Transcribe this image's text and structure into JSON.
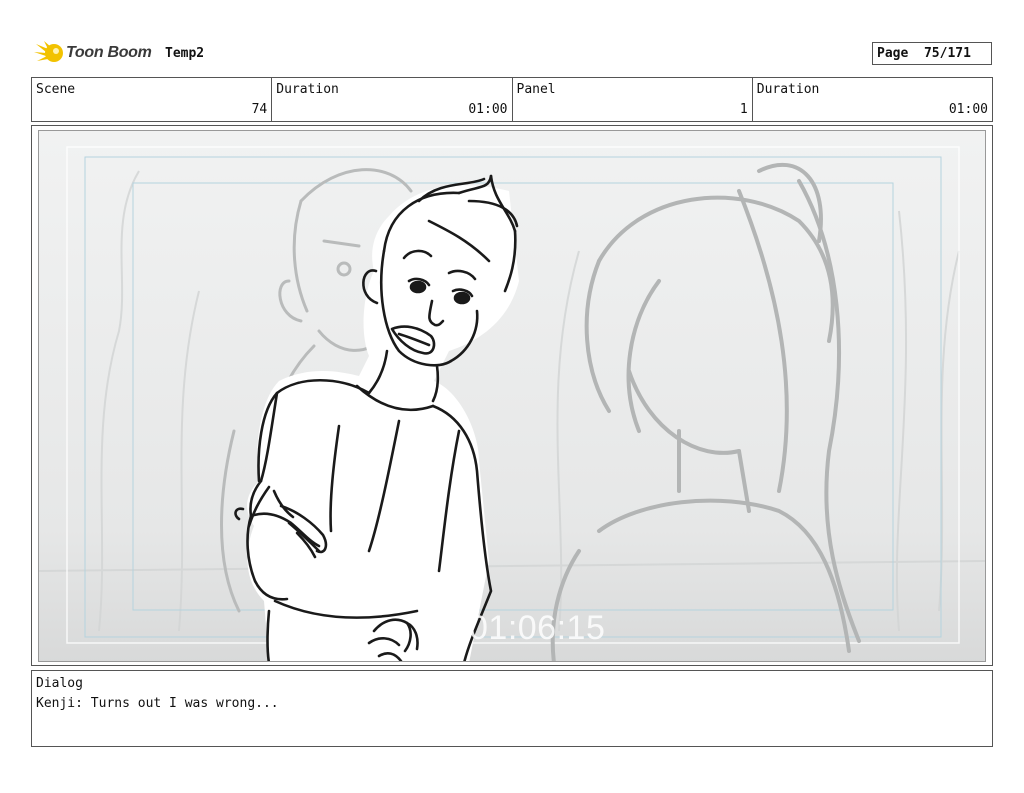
{
  "header": {
    "brand": "Toon Boom",
    "project": "Temp2",
    "page_label": "Page",
    "page_value": "75/171"
  },
  "info": {
    "scene_label": "Scene",
    "scene_value": "74",
    "scene_duration_label": "Duration",
    "scene_duration_value": "01:00",
    "panel_label": "Panel",
    "panel_value": "1",
    "panel_duration_label": "Duration",
    "panel_duration_value": "01:00"
  },
  "panel": {
    "timecode": "01:06:15"
  },
  "dialog": {
    "label": "Dialog",
    "text": "Kenji: Turns out I was wrong..."
  },
  "colors": {
    "logo_yellow": "#f2c200",
    "frame_guides": "#a9c9d6"
  }
}
